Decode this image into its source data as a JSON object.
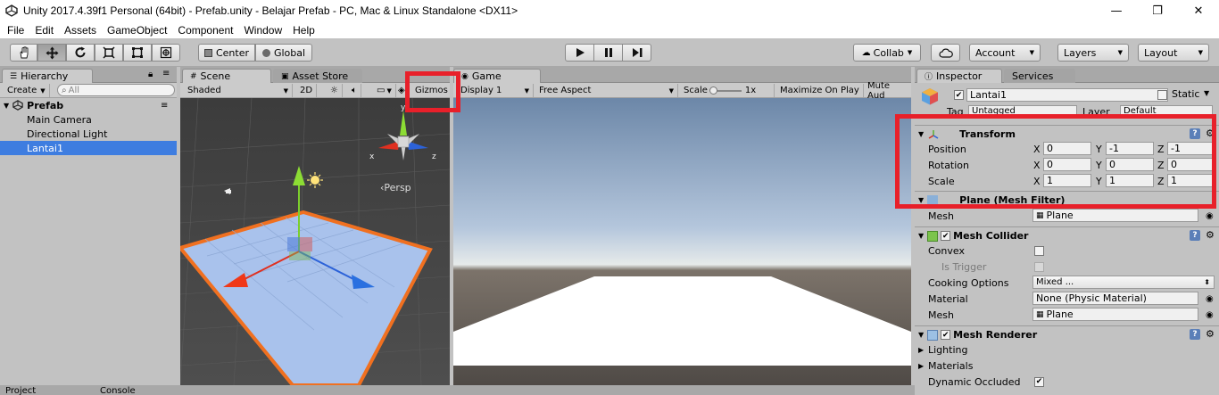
{
  "window": {
    "title": "Unity 2017.4.39f1 Personal (64bit) - Prefab.unity - Belajar Prefab - PC, Mac & Linux Standalone <DX11>",
    "minimize": "—",
    "restore": "❐",
    "close": "✕"
  },
  "menu": [
    "File",
    "Edit",
    "Assets",
    "GameObject",
    "Component",
    "Window",
    "Help"
  ],
  "toolbar": {
    "pivot_label": "Center",
    "space_label": "Global",
    "collab_label": "Collab",
    "account_label": "Account",
    "layers_label": "Layers",
    "layout_label": "Layout"
  },
  "hierarchy": {
    "tab": "Hierarchy",
    "create_label": "Create",
    "search_placeholder": "All",
    "scene_name": "Prefab",
    "items": [
      "Main Camera",
      "Directional Light",
      "Lantai1"
    ]
  },
  "scene": {
    "tab": "Scene",
    "asset_store_tab": "Asset Store",
    "shading": "Shaded",
    "mode_2d": "2D",
    "gizmos": "Gizmos",
    "persp": "Persp",
    "axis_y": "y",
    "axis_x": "x",
    "axis_z": "z"
  },
  "game": {
    "tab": "Game",
    "display": "Display 1",
    "aspect": "Free Aspect",
    "scale_label": "Scale",
    "scale_value": "1x",
    "maximize": "Maximize On Play",
    "mute": "Mute Aud"
  },
  "inspector": {
    "tab": "Inspector",
    "services_tab": "Services",
    "object_name": "Lantai1",
    "static_label": "Static",
    "tag_label": "Tag",
    "tag_value": "Untagged",
    "layer_label": "Layer",
    "layer_value": "Default",
    "transform": {
      "title": "Transform",
      "position_label": "Position",
      "rotation_label": "Rotation",
      "scale_label": "Scale",
      "position": {
        "x": "0",
        "y": "-1",
        "z": "-1"
      },
      "rotation": {
        "x": "0",
        "y": "0",
        "z": "0"
      },
      "scale": {
        "x": "1",
        "y": "1",
        "z": "1"
      }
    },
    "mesh_filter": {
      "title": "Plane (Mesh Filter)",
      "mesh_label": "Mesh",
      "mesh_value": "Plane"
    },
    "mesh_collider": {
      "title": "Mesh Collider",
      "convex_label": "Convex",
      "is_trigger_label": "Is Trigger",
      "cooking_label": "Cooking Options",
      "cooking_value": "Mixed ...",
      "material_label": "Material",
      "material_value": "None (Physic Material)",
      "mesh_label": "Mesh",
      "mesh_value": "Plane"
    },
    "mesh_renderer": {
      "title": "Mesh Renderer",
      "lighting_label": "Lighting",
      "materials_label": "Materials",
      "dynamic_occluded_label": "Dynamic Occluded"
    }
  },
  "bottom_tabs": [
    "Project",
    "Console"
  ],
  "colors": {
    "highlight_red": "#e8202a",
    "selection_blue": "#3e7de0",
    "plane_outline": "#f07020"
  }
}
